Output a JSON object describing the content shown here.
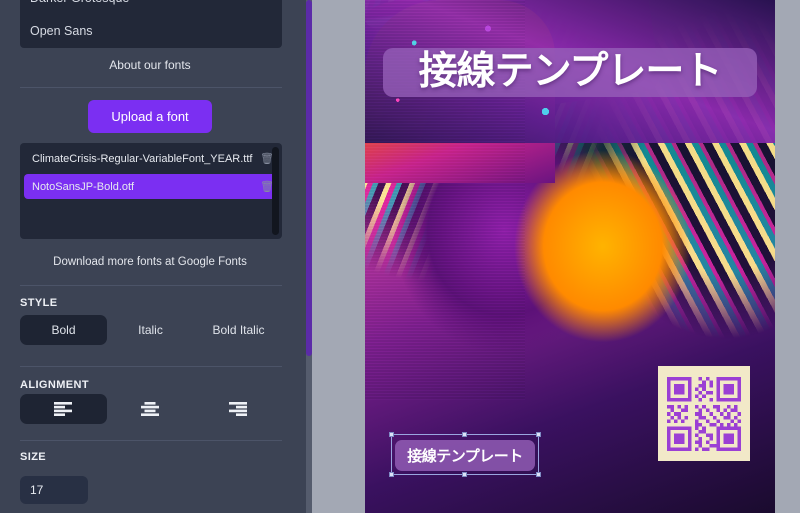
{
  "panel": {
    "font_dropdown": {
      "options": [
        "Darker Grotesque",
        "Open Sans"
      ]
    },
    "about_fonts_link": "About our fonts",
    "upload_button": "Upload a font",
    "uploaded_fonts": [
      {
        "name": "ClimateCrisis-Regular-VariableFont_YEAR.ttf",
        "selected": false,
        "delete_icon": "trash-icon"
      },
      {
        "name": "NotoSansJP-Bold.otf",
        "selected": true,
        "delete_icon": "trash-icon"
      }
    ],
    "download_fonts_link": "Download more fonts at Google Fonts",
    "style": {
      "label": "STYLE",
      "options": [
        "Bold",
        "Italic",
        "Bold Italic"
      ],
      "selected": "Bold"
    },
    "alignment": {
      "label": "ALIGNMENT",
      "options": [
        "align-left-icon",
        "align-center-icon",
        "align-right-icon"
      ],
      "selected": "align-left-icon"
    },
    "size": {
      "label": "SIZE",
      "value": "17",
      "placeholder": "17"
    }
  },
  "canvas": {
    "poster": {
      "title": "接線テンプレート",
      "subtitle": "接線テンプレート",
      "qr_label": "qr-code"
    }
  },
  "colors": {
    "accent_purple": "#7b2ff2",
    "panel_bg": "#3c4354",
    "panel_dark": "#222838",
    "canvas_bg": "#a3a8b4",
    "text_overlay_bg": "#9660b9",
    "qr_fg": "#9b3fd4",
    "qr_bg": "#f2e9c8"
  }
}
